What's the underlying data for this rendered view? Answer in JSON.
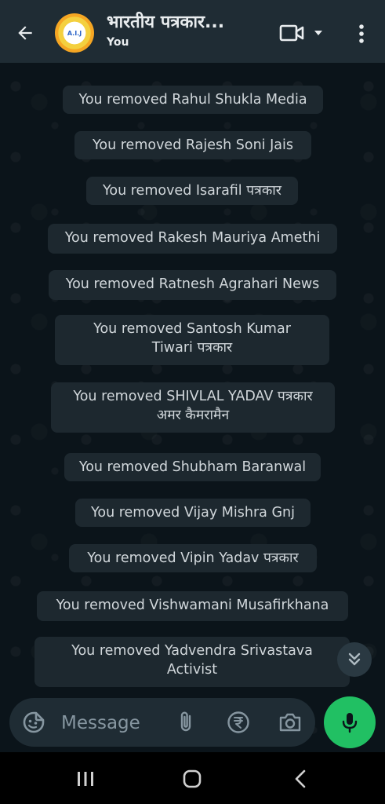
{
  "header": {
    "title": "भारतीय पत्रकार...",
    "subtitle": "You",
    "avatar_text": "A.I.J"
  },
  "messages": [
    "You removed Rahul Shukla Media",
    "You removed Rajesh Soni Jais",
    "You removed Isarafil पत्रकार",
    "You removed Rakesh Mauriya Amethi",
    "You removed Ratnesh Agrahari News",
    "You removed Santosh Kumar Tiwari पत्रकार",
    "You removed SHIVLAL YADAV पत्रकार अमर कैमरामैन",
    "You removed Shubham Baranwal",
    "You removed Vijay Mishra Gnj",
    "You removed Vipin Yadav पत्रकार",
    "You removed Vishwamani Musafirkhana",
    "You removed Yadvendra Srivastava Activist"
  ],
  "composer": {
    "placeholder": "Message"
  },
  "colors": {
    "accent": "#21c063",
    "header_bg": "#1f2c34",
    "chat_bg": "#0b141a",
    "system_bubble": "#1d282f"
  },
  "icons": [
    "back-arrow-icon",
    "video-camera-icon",
    "dropdown-caret-icon",
    "more-vertical-icon",
    "sticker-icon",
    "paperclip-icon",
    "rupee-icon",
    "camera-icon",
    "microphone-icon",
    "double-chevron-down-icon",
    "recents-icon",
    "home-icon",
    "back-nav-icon"
  ]
}
